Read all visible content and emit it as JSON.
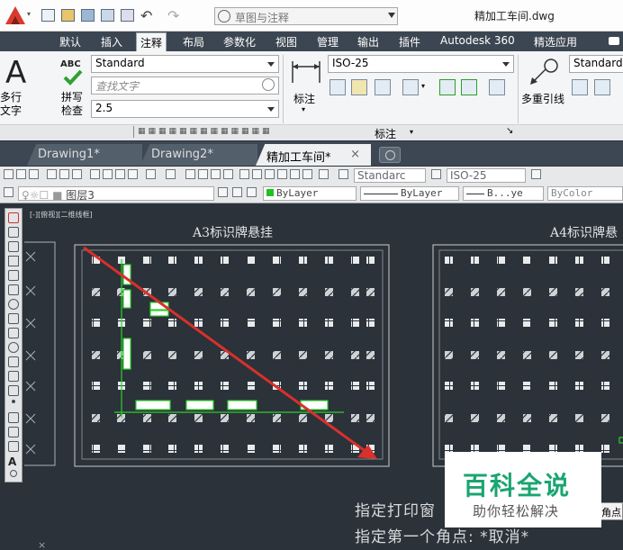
{
  "titlebar": {
    "workspace": "草图与注释",
    "filename": "精加工车间.dwg"
  },
  "menu_tabs": [
    "默认",
    "插入",
    "注释",
    "布局",
    "参数化",
    "视图",
    "管理",
    "输出",
    "插件",
    "Autodesk 360",
    "精选应用"
  ],
  "ribbon": {
    "text_big_label": "多行\n文字",
    "abc_label": "ABC",
    "spell_label": "拼写\n检查",
    "text_style": "Standard",
    "find_placeholder": "查找文字",
    "text_height": "2.5",
    "dim_label": "标注",
    "dim_style": "ISO-25",
    "mleader_label": "多重引线",
    "mleader_style": "Standard",
    "panel_title": "标注"
  },
  "doc_tabs": [
    {
      "label": "Drawing1*"
    },
    {
      "label": "Drawing2*"
    },
    {
      "label": "精加工车间*"
    }
  ],
  "toolbar": {
    "text_style": "Standarc",
    "dim_style": "ISO-25",
    "layer": "图层3",
    "color": "ByLayer",
    "linetype": "ByLayer",
    "lineweight": "B...ye",
    "plotstyle": "ByColor"
  },
  "canvas": {
    "view_label": "[-][俯视][二维线框]",
    "sheet_a3_title": "A3标识牌悬挂",
    "sheet_a4_title": "A4标识牌悬",
    "prompt_line1": "指定打印窗",
    "prompt_line2": "指定第一个角点: *取消*",
    "corner_tag": "角点"
  },
  "watermark": {
    "title": "百科全说",
    "subtitle": "助你轻松解决"
  },
  "colors": {
    "accent_red": "#d9302c",
    "green": "#2bd02b",
    "canvas_bg": "#2b3239"
  }
}
